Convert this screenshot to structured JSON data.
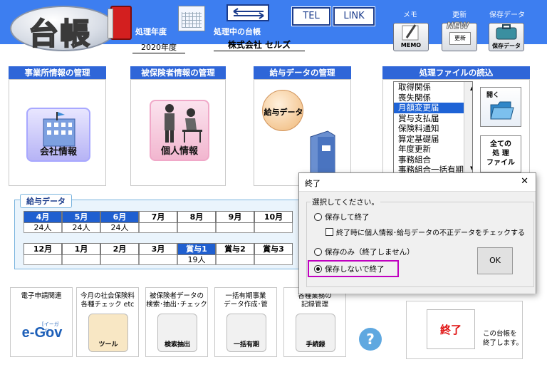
{
  "header": {
    "app_title": "台帳",
    "year_label": "処理年度",
    "year_value": "2020年度",
    "ledger_label": "処理中の台帳",
    "ledger_value": "株式会社 セルズ",
    "tel_label": "TEL",
    "link_label": "LINK",
    "memo_title": "メモ",
    "memo_icon_text": "MEMO",
    "update_title": "更新",
    "update_badge": "NEW",
    "update_icon_text": "更新",
    "save_title": "保存データ",
    "save_icon_text": "保存データ"
  },
  "sections": {
    "office": {
      "title": "事業所情報の管理",
      "icon_label": "会社情報"
    },
    "insured": {
      "title": "被保険者情報の管理",
      "icon_label": "個人情報"
    },
    "salary": {
      "title": "給与データの管理",
      "icon_label": "給与データ"
    },
    "files": {
      "title": "処理ファイルの読込",
      "items": [
        "取得関係",
        "喪失関係",
        "月額変更届",
        "賞与支払届",
        "保険料通知",
        "算定基礎届",
        "年度更新",
        "事務組合",
        "事務組合一括有期"
      ],
      "selected_index": 2,
      "open_label": "開く",
      "all_files_label_1": "全ての",
      "all_files_label_2": "処 理",
      "all_files_label_3": "ファイル"
    }
  },
  "salary_grid": {
    "title": "給与データ",
    "row1": [
      {
        "label": "4月",
        "value": "24人",
        "active": true
      },
      {
        "label": "5月",
        "value": "24人",
        "active": true
      },
      {
        "label": "6月",
        "value": "24人",
        "active": true
      },
      {
        "label": "7月",
        "value": "",
        "active": false
      },
      {
        "label": "8月",
        "value": "",
        "active": false
      },
      {
        "label": "9月",
        "value": "",
        "active": false
      },
      {
        "label": "10月",
        "value": "",
        "active": false
      }
    ],
    "row2": [
      {
        "label": "12月",
        "value": "",
        "active": false
      },
      {
        "label": "1月",
        "value": "",
        "active": false
      },
      {
        "label": "2月",
        "value": "",
        "active": false
      },
      {
        "label": "3月",
        "value": "",
        "active": false
      },
      {
        "label": "賞与1",
        "value": "19人",
        "active": true
      },
      {
        "label": "賞与2",
        "value": "",
        "active": false
      },
      {
        "label": "賞与3",
        "value": "",
        "active": false
      }
    ]
  },
  "tools": [
    {
      "title1": "電子申請関連",
      "title2": "",
      "label": "e-Gov"
    },
    {
      "title1": "今月の社会保険料",
      "title2": "各種チェック etc",
      "label": "ツール"
    },
    {
      "title1": "被保険者データの",
      "title2": "検索･抽出･チェック",
      "label": "検索抽出"
    },
    {
      "title1": "一括有期事業",
      "title2": "データ作成･管",
      "label": "一括有期"
    },
    {
      "title1": "各種業務の",
      "title2": "記録管理",
      "label": "手続録"
    }
  ],
  "egov_sub": "[イーガブ]",
  "help_symbol": "?",
  "exit": {
    "label": "終了",
    "desc1": "この台帳を",
    "desc2": "終了します。"
  },
  "dialog": {
    "title": "終了",
    "close_symbol": "✕",
    "prompt": "選択してください。",
    "opt1": "保存して終了",
    "opt1_check": "終了時に個人情報･給与データの不正データをチェックする",
    "opt2": "保存のみ（終了しません）",
    "opt3": "保存しないで終了",
    "selected": 3,
    "ok_label": "OK"
  },
  "colors": {
    "header_blue": "#3d7ef0",
    "section_blue": "#2f66d8",
    "highlight_magenta": "#c000c0"
  }
}
